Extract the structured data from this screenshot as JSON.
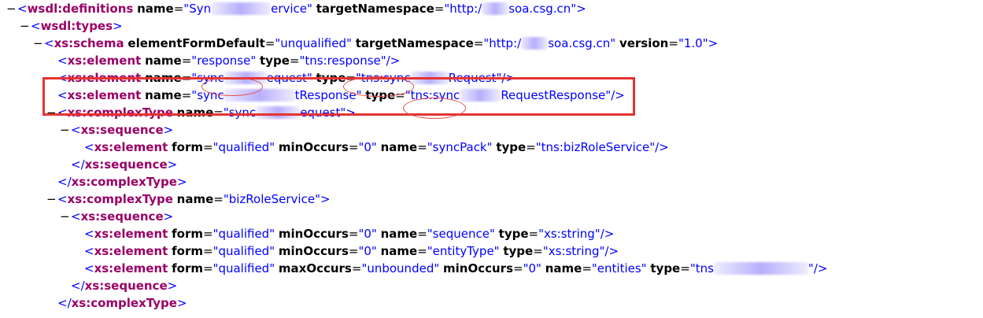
{
  "colors": {
    "tag": "#990066",
    "attribute": "#000000",
    "value": "#0000ff",
    "bracket": "#0000ff",
    "highlight": "#e53333"
  },
  "toggle_symbol": "−",
  "lines": [
    {
      "indent": 0,
      "toggle": true,
      "tokens": [
        {
          "t": "b",
          "v": "<"
        },
        {
          "t": "tag",
          "v": "wsdl:definitions"
        },
        {
          "t": "s",
          "v": " "
        },
        {
          "t": "attr",
          "v": "name"
        },
        {
          "t": "eq",
          "v": "="
        },
        {
          "t": "val",
          "v": "\"Syn"
        },
        {
          "t": "blur",
          "v": "",
          "w": 76
        },
        {
          "t": "val",
          "v": "ervice\""
        },
        {
          "t": "s",
          "v": " "
        },
        {
          "t": "attr",
          "v": "targetNamespace"
        },
        {
          "t": "eq",
          "v": "="
        },
        {
          "t": "val",
          "v": "\"http:/"
        },
        {
          "t": "blur",
          "v": "",
          "w": 34
        },
        {
          "t": "val",
          "v": "soa.csg.cn\""
        },
        {
          "t": "b",
          "v": ">"
        }
      ]
    },
    {
      "indent": 1,
      "toggle": true,
      "tokens": [
        {
          "t": "b",
          "v": "<"
        },
        {
          "t": "tag",
          "v": "wsdl:types"
        },
        {
          "t": "b",
          "v": ">"
        }
      ]
    },
    {
      "indent": 2,
      "toggle": true,
      "tokens": [
        {
          "t": "b",
          "v": "<"
        },
        {
          "t": "tag",
          "v": "xs:schema"
        },
        {
          "t": "s",
          "v": " "
        },
        {
          "t": "attr",
          "v": "elementFormDefault"
        },
        {
          "t": "eq",
          "v": "="
        },
        {
          "t": "val",
          "v": "\"unqualified\""
        },
        {
          "t": "s",
          "v": " "
        },
        {
          "t": "attr",
          "v": "targetNamespace"
        },
        {
          "t": "eq",
          "v": "="
        },
        {
          "t": "val",
          "v": "\"http:/"
        },
        {
          "t": "blur",
          "v": "",
          "w": 34
        },
        {
          "t": "val",
          "v": "soa.csg.cn\""
        },
        {
          "t": "s",
          "v": " "
        },
        {
          "t": "attr",
          "v": "version"
        },
        {
          "t": "eq",
          "v": "="
        },
        {
          "t": "val",
          "v": "\"1.0\""
        },
        {
          "t": "b",
          "v": ">"
        }
      ]
    },
    {
      "indent": 3,
      "toggle": false,
      "tokens": [
        {
          "t": "b",
          "v": "<"
        },
        {
          "t": "tag",
          "v": "xs:element"
        },
        {
          "t": "s",
          "v": " "
        },
        {
          "t": "attr",
          "v": "name"
        },
        {
          "t": "eq",
          "v": "="
        },
        {
          "t": "val",
          "v": "\"response\""
        },
        {
          "t": "s",
          "v": " "
        },
        {
          "t": "attr",
          "v": "type"
        },
        {
          "t": "eq",
          "v": "="
        },
        {
          "t": "val",
          "v": "\"tns:response\""
        },
        {
          "t": "b",
          "v": "/>"
        }
      ]
    },
    {
      "indent": 3,
      "toggle": false,
      "tokens": [
        {
          "t": "b",
          "v": "<"
        },
        {
          "t": "tag",
          "v": "xs:element"
        },
        {
          "t": "s",
          "v": " "
        },
        {
          "t": "attr",
          "v": "name"
        },
        {
          "t": "eq",
          "v": "="
        },
        {
          "t": "val",
          "v": "\"sync"
        },
        {
          "t": "blur",
          "v": "",
          "w": 54
        },
        {
          "t": "val",
          "v": "equest\""
        },
        {
          "t": "s",
          "v": " "
        },
        {
          "t": "attr",
          "v": "type"
        },
        {
          "t": "eq",
          "v": "="
        },
        {
          "t": "val",
          "v": "\"tns:sync"
        },
        {
          "t": "blur",
          "v": "",
          "w": 48
        },
        {
          "t": "val",
          "v": "Request\""
        },
        {
          "t": "b",
          "v": "/>"
        }
      ]
    },
    {
      "indent": 3,
      "toggle": false,
      "tokens": [
        {
          "t": "b",
          "v": "<"
        },
        {
          "t": "tag",
          "v": "xs:element"
        },
        {
          "t": "s",
          "v": " "
        },
        {
          "t": "attr",
          "v": "name"
        },
        {
          "t": "eq",
          "v": "="
        },
        {
          "t": "val",
          "v": "\"sync"
        },
        {
          "t": "blur",
          "v": "",
          "w": 90
        },
        {
          "t": "val",
          "v": "tResponse\""
        },
        {
          "t": "s",
          "v": " "
        },
        {
          "t": "attr",
          "v": "type"
        },
        {
          "t": "eq",
          "v": "="
        },
        {
          "t": "val",
          "v": "\"tns:sync"
        },
        {
          "t": "blur",
          "v": "",
          "w": 52
        },
        {
          "t": "val",
          "v": "RequestResponse\""
        },
        {
          "t": "b",
          "v": "/>"
        }
      ]
    },
    {
      "indent": 3,
      "toggle": true,
      "tokens": [
        {
          "t": "b",
          "v": "<"
        },
        {
          "t": "tag",
          "v": "xs:complexType"
        },
        {
          "t": "s",
          "v": " "
        },
        {
          "t": "attr",
          "v": "name"
        },
        {
          "t": "eq",
          "v": "="
        },
        {
          "t": "val",
          "v": "\"sync"
        },
        {
          "t": "blur",
          "v": "",
          "w": 56
        },
        {
          "t": "val",
          "v": "equest\""
        },
        {
          "t": "b",
          "v": ">"
        }
      ]
    },
    {
      "indent": 4,
      "toggle": true,
      "tokens": [
        {
          "t": "b",
          "v": "<"
        },
        {
          "t": "tag",
          "v": "xs:sequence"
        },
        {
          "t": "b",
          "v": ">"
        }
      ]
    },
    {
      "indent": 5,
      "toggle": false,
      "tokens": [
        {
          "t": "b",
          "v": "<"
        },
        {
          "t": "tag",
          "v": "xs:element"
        },
        {
          "t": "s",
          "v": " "
        },
        {
          "t": "attr",
          "v": "form"
        },
        {
          "t": "eq",
          "v": "="
        },
        {
          "t": "val",
          "v": "\"qualified\""
        },
        {
          "t": "s",
          "v": " "
        },
        {
          "t": "attr",
          "v": "minOccurs"
        },
        {
          "t": "eq",
          "v": "="
        },
        {
          "t": "val",
          "v": "\"0\""
        },
        {
          "t": "s",
          "v": " "
        },
        {
          "t": "attr",
          "v": "name"
        },
        {
          "t": "eq",
          "v": "="
        },
        {
          "t": "val",
          "v": "\"syncPack\""
        },
        {
          "t": "s",
          "v": " "
        },
        {
          "t": "attr",
          "v": "type"
        },
        {
          "t": "eq",
          "v": "="
        },
        {
          "t": "val",
          "v": "\"tns:bizRoleService\""
        },
        {
          "t": "b",
          "v": "/>"
        }
      ]
    },
    {
      "indent": 4,
      "toggle": false,
      "tokens": [
        {
          "t": "b",
          "v": "</"
        },
        {
          "t": "tag",
          "v": "xs:sequence"
        },
        {
          "t": "b",
          "v": ">"
        }
      ]
    },
    {
      "indent": 3,
      "toggle": false,
      "tokens": [
        {
          "t": "b",
          "v": "</"
        },
        {
          "t": "tag",
          "v": "xs:complexType"
        },
        {
          "t": "b",
          "v": ">"
        }
      ]
    },
    {
      "indent": 3,
      "toggle": true,
      "tokens": [
        {
          "t": "b",
          "v": "<"
        },
        {
          "t": "tag",
          "v": "xs:complexType"
        },
        {
          "t": "s",
          "v": " "
        },
        {
          "t": "attr",
          "v": "name"
        },
        {
          "t": "eq",
          "v": "="
        },
        {
          "t": "val",
          "v": "\"bizRoleService\""
        },
        {
          "t": "b",
          "v": ">"
        }
      ]
    },
    {
      "indent": 4,
      "toggle": true,
      "tokens": [
        {
          "t": "b",
          "v": "<"
        },
        {
          "t": "tag",
          "v": "xs:sequence"
        },
        {
          "t": "b",
          "v": ">"
        }
      ]
    },
    {
      "indent": 5,
      "toggle": false,
      "tokens": [
        {
          "t": "b",
          "v": "<"
        },
        {
          "t": "tag",
          "v": "xs:element"
        },
        {
          "t": "s",
          "v": " "
        },
        {
          "t": "attr",
          "v": "form"
        },
        {
          "t": "eq",
          "v": "="
        },
        {
          "t": "val",
          "v": "\"qualified\""
        },
        {
          "t": "s",
          "v": " "
        },
        {
          "t": "attr",
          "v": "minOccurs"
        },
        {
          "t": "eq",
          "v": "="
        },
        {
          "t": "val",
          "v": "\"0\""
        },
        {
          "t": "s",
          "v": " "
        },
        {
          "t": "attr",
          "v": "name"
        },
        {
          "t": "eq",
          "v": "="
        },
        {
          "t": "val",
          "v": "\"sequence\""
        },
        {
          "t": "s",
          "v": " "
        },
        {
          "t": "attr",
          "v": "type"
        },
        {
          "t": "eq",
          "v": "="
        },
        {
          "t": "val",
          "v": "\"xs:string\""
        },
        {
          "t": "b",
          "v": "/>"
        }
      ]
    },
    {
      "indent": 5,
      "toggle": false,
      "tokens": [
        {
          "t": "b",
          "v": "<"
        },
        {
          "t": "tag",
          "v": "xs:element"
        },
        {
          "t": "s",
          "v": " "
        },
        {
          "t": "attr",
          "v": "form"
        },
        {
          "t": "eq",
          "v": "="
        },
        {
          "t": "val",
          "v": "\"qualified\""
        },
        {
          "t": "s",
          "v": " "
        },
        {
          "t": "attr",
          "v": "minOccurs"
        },
        {
          "t": "eq",
          "v": "="
        },
        {
          "t": "val",
          "v": "\"0\""
        },
        {
          "t": "s",
          "v": " "
        },
        {
          "t": "attr",
          "v": "name"
        },
        {
          "t": "eq",
          "v": "="
        },
        {
          "t": "val",
          "v": "\"entityType\""
        },
        {
          "t": "s",
          "v": " "
        },
        {
          "t": "attr",
          "v": "type"
        },
        {
          "t": "eq",
          "v": "="
        },
        {
          "t": "val",
          "v": "\"xs:string\""
        },
        {
          "t": "b",
          "v": "/>"
        }
      ]
    },
    {
      "indent": 5,
      "toggle": false,
      "tokens": [
        {
          "t": "b",
          "v": "<"
        },
        {
          "t": "tag",
          "v": "xs:element"
        },
        {
          "t": "s",
          "v": " "
        },
        {
          "t": "attr",
          "v": "form"
        },
        {
          "t": "eq",
          "v": "="
        },
        {
          "t": "val",
          "v": "\"qualified\""
        },
        {
          "t": "s",
          "v": " "
        },
        {
          "t": "attr",
          "v": "maxOccurs"
        },
        {
          "t": "eq",
          "v": "="
        },
        {
          "t": "val",
          "v": "\"unbounded\""
        },
        {
          "t": "s",
          "v": " "
        },
        {
          "t": "attr",
          "v": "minOccurs"
        },
        {
          "t": "eq",
          "v": "="
        },
        {
          "t": "val",
          "v": "\"0\""
        },
        {
          "t": "s",
          "v": " "
        },
        {
          "t": "attr",
          "v": "name"
        },
        {
          "t": "eq",
          "v": "="
        },
        {
          "t": "val",
          "v": "\"entities\""
        },
        {
          "t": "s",
          "v": " "
        },
        {
          "t": "attr",
          "v": "type"
        },
        {
          "t": "eq",
          "v": "="
        },
        {
          "t": "val",
          "v": "\"tns"
        },
        {
          "t": "blur",
          "v": "",
          "w": 120
        },
        {
          "t": "val",
          "v": "\""
        },
        {
          "t": "b",
          "v": "/>"
        }
      ]
    },
    {
      "indent": 4,
      "toggle": false,
      "tokens": [
        {
          "t": "b",
          "v": "</"
        },
        {
          "t": "tag",
          "v": "xs:sequence"
        },
        {
          "t": "b",
          "v": ">"
        }
      ]
    },
    {
      "indent": 3,
      "toggle": false,
      "tokens": [
        {
          "t": "b",
          "v": "</"
        },
        {
          "t": "tag",
          "v": "xs:complexType"
        },
        {
          "t": "b",
          "v": ">"
        }
      ]
    }
  ]
}
